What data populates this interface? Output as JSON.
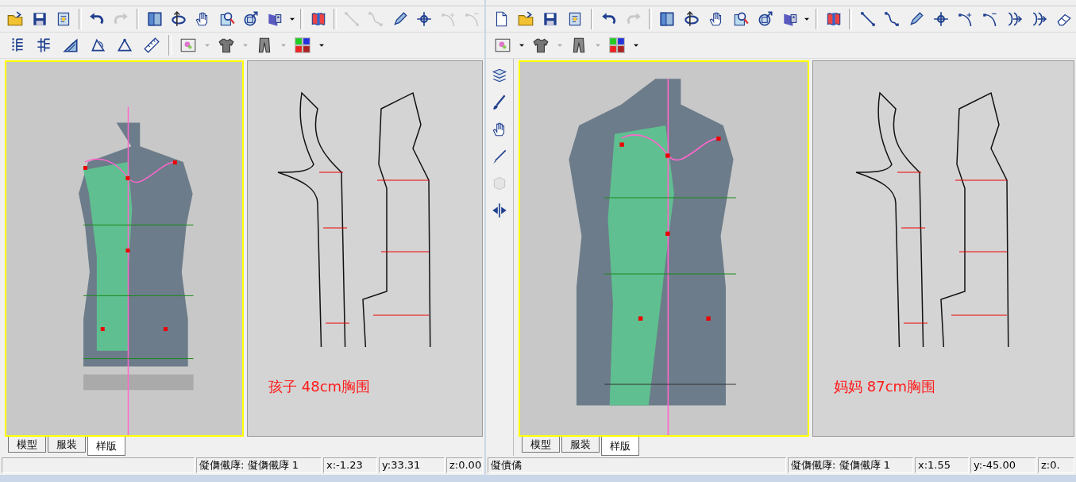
{
  "windows": [
    {
      "toolbar_rows": [
        [
          {
            "kind": "open",
            "disabled": false
          },
          {
            "kind": "save",
            "disabled": false
          },
          {
            "kind": "props",
            "disabled": false
          },
          {
            "kind": "separator"
          },
          {
            "kind": "undo",
            "disabled": false
          },
          {
            "kind": "redo",
            "disabled": true
          },
          {
            "kind": "separator"
          },
          {
            "kind": "view",
            "disabled": false
          },
          {
            "kind": "rotate",
            "disabled": false
          },
          {
            "kind": "hand",
            "disabled": false
          },
          {
            "kind": "zoom",
            "disabled": false
          },
          {
            "kind": "fit",
            "disabled": false
          },
          {
            "kind": "texture",
            "disabled": false
          },
          {
            "kind": "caret",
            "disabled": false
          },
          {
            "kind": "separator"
          },
          {
            "kind": "flag",
            "disabled": false
          },
          {
            "kind": "separator"
          },
          {
            "kind": "line",
            "disabled": true
          },
          {
            "kind": "curve",
            "disabled": true
          },
          {
            "kind": "pencil",
            "disabled": false
          },
          {
            "kind": "point",
            "disabled": false
          },
          {
            "kind": "curve-add",
            "disabled": true
          },
          {
            "kind": "curve-remove",
            "disabled": true
          }
        ],
        [
          {
            "kind": "ruler-dots",
            "disabled": false
          },
          {
            "kind": "ruler-cross",
            "disabled": false
          },
          {
            "kind": "angle",
            "disabled": false
          },
          {
            "kind": "triangle",
            "disabled": false
          },
          {
            "kind": "triangle-alt",
            "disabled": false
          },
          {
            "kind": "ruler",
            "disabled": false
          },
          {
            "kind": "separator"
          },
          {
            "kind": "image",
            "disabled": false
          },
          {
            "kind": "caret",
            "disabled": true
          },
          {
            "kind": "shirt",
            "disabled": false
          },
          {
            "kind": "caret",
            "disabled": true
          },
          {
            "kind": "pants",
            "disabled": false
          },
          {
            "kind": "caret",
            "disabled": true
          },
          {
            "kind": "grid",
            "disabled": false
          },
          {
            "kind": "caret",
            "disabled": false
          }
        ]
      ],
      "view_tabs": [
        {
          "label": "模型",
          "selected": false
        },
        {
          "label": "服装",
          "selected": false
        },
        {
          "label": "样版",
          "selected": true
        }
      ],
      "annotation": "孩子 48cm胸围",
      "status": {
        "layer": "儗儛儎庨: 儗儛儎庨 1",
        "x": "x:-1.23",
        "y": "y:33.31",
        "z": "z:0.00"
      }
    },
    {
      "toolbar_rows": [
        [
          {
            "kind": "new",
            "disabled": false
          },
          {
            "kind": "open",
            "disabled": false
          },
          {
            "kind": "save",
            "disabled": false
          },
          {
            "kind": "props",
            "disabled": false
          },
          {
            "kind": "separator"
          },
          {
            "kind": "undo",
            "disabled": false
          },
          {
            "kind": "redo",
            "disabled": true
          },
          {
            "kind": "separator"
          },
          {
            "kind": "view",
            "disabled": false
          },
          {
            "kind": "rotate",
            "disabled": false
          },
          {
            "kind": "hand",
            "disabled": false
          },
          {
            "kind": "zoom",
            "disabled": false
          },
          {
            "kind": "fit",
            "disabled": false
          },
          {
            "kind": "texture",
            "disabled": false
          },
          {
            "kind": "caret",
            "disabled": false
          },
          {
            "kind": "separator"
          },
          {
            "kind": "flag",
            "disabled": false
          },
          {
            "kind": "separator"
          },
          {
            "kind": "line",
            "disabled": false
          },
          {
            "kind": "curve",
            "disabled": false
          },
          {
            "kind": "pencil",
            "disabled": false
          },
          {
            "kind": "point",
            "disabled": false
          },
          {
            "kind": "curve-add",
            "disabled": false
          },
          {
            "kind": "curve-remove",
            "disabled": false
          },
          {
            "kind": "split",
            "disabled": false
          },
          {
            "kind": "split",
            "disabled": false
          },
          {
            "kind": "eraser",
            "disabled": false
          }
        ],
        [
          {
            "kind": "image",
            "disabled": false
          },
          {
            "kind": "caret",
            "disabled": false
          },
          {
            "kind": "shirt",
            "disabled": false
          },
          {
            "kind": "caret",
            "disabled": true
          },
          {
            "kind": "pants",
            "disabled": false
          },
          {
            "kind": "caret",
            "disabled": true
          },
          {
            "kind": "grid",
            "disabled": false
          },
          {
            "kind": "caret",
            "disabled": false
          }
        ]
      ],
      "side_toolbar": [
        {
          "kind": "layers",
          "disabled": false
        },
        {
          "kind": "brush",
          "disabled": false
        },
        {
          "kind": "hand",
          "disabled": false
        },
        {
          "kind": "pen",
          "disabled": false
        },
        {
          "kind": "cube",
          "disabled": true
        },
        {
          "kind": "mirror",
          "disabled": false
        }
      ],
      "view_tabs": [
        {
          "label": "模型",
          "selected": false
        },
        {
          "label": "服装",
          "selected": false
        },
        {
          "label": "样版",
          "selected": true
        }
      ],
      "annotation": "妈妈 87cm胸围",
      "status": {
        "message": "儗債僪",
        "layer": "儗儛儎庨: 儗儛儎庨 1",
        "x": "x:1.55",
        "y": "y:-45.00",
        "z": "z:0."
      }
    }
  ]
}
